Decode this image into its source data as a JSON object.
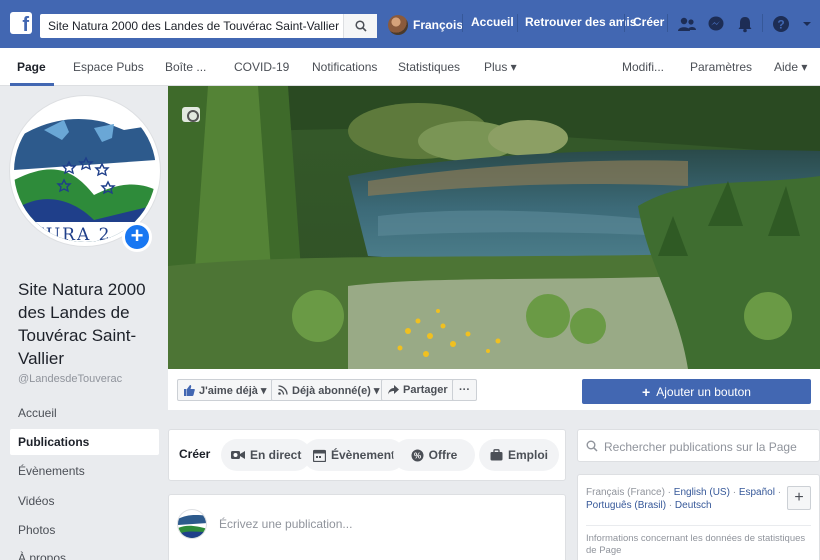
{
  "topbar": {
    "search_value": "Site Natura 2000 des Landes de Touvérac Saint-Vallier",
    "user_name": "François",
    "links": [
      "Accueil",
      "Retrouver des amis",
      "Créer"
    ],
    "icons": [
      "friends-icon",
      "messenger-icon",
      "notifications-icon",
      "help-icon",
      "dropdown-arrow-icon"
    ]
  },
  "tabs": {
    "items": [
      "Page",
      "Espace Pubs",
      "Boîte ...",
      "COVID-19",
      "Notifications",
      "Statistiques",
      "Plus ▾"
    ],
    "right": [
      "Modifi...",
      "Paramètres",
      "Aide ▾"
    ],
    "active": "Page"
  },
  "profile": {
    "logo_text": "TURA 2",
    "name": "Site Natura 2000 des Landes de Touvérac Saint-Vallier",
    "handle": "@LandesdeTouverac"
  },
  "sidebar": {
    "items": [
      "Accueil",
      "Publications",
      "Évènements",
      "Vidéos",
      "Photos",
      "À propos"
    ],
    "active": "Publications"
  },
  "actions": {
    "like": "J'aime déjà ▾",
    "follow": "Déjà abonné(e) ▾",
    "share": "Partager",
    "more": "···",
    "add_button": "Ajouter un bouton"
  },
  "create": {
    "label": "Créer",
    "pills": [
      "En direct",
      "Évènement",
      "Offre",
      "Emploi"
    ]
  },
  "post": {
    "placeholder": "Écrivez une publication..."
  },
  "right": {
    "search_placeholder": "Rechercher publications sur la Page",
    "lang_line1_current": "Français (France)",
    "lang_line1_links": [
      "English (US)",
      "Español"
    ],
    "lang_line2_links": [
      "Português (Brasil)",
      "Deutsch"
    ],
    "plus": "+",
    "stats_info": "Informations concernant les données de statistiques de Page"
  },
  "colors": {
    "brand_blue": "#4267b2",
    "link_blue": "#365899",
    "background": "#e9ebee"
  }
}
